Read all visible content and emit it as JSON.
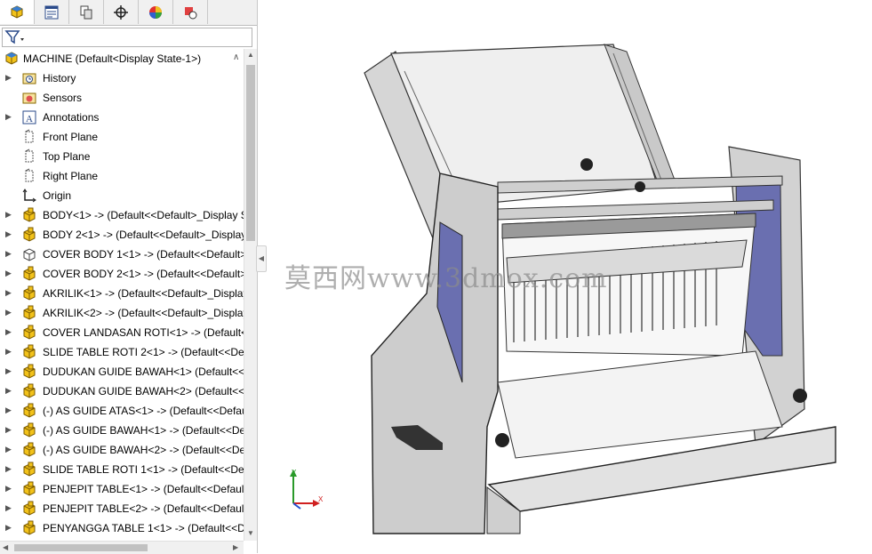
{
  "tabs": [
    {
      "name": "feature-manager-tab",
      "icon": "featuremanager-icon",
      "active": true
    },
    {
      "name": "property-manager-tab",
      "icon": "propertymanager-icon",
      "active": false
    },
    {
      "name": "configuration-manager-tab",
      "icon": "configurationmanager-icon",
      "active": false
    },
    {
      "name": "dimxpert-manager-tab",
      "icon": "crosshair-icon",
      "active": false
    },
    {
      "name": "display-manager-tab",
      "icon": "appearance-sphere-icon",
      "active": false
    },
    {
      "name": "extra-tab",
      "icon": "hand-tool-icon",
      "active": false
    }
  ],
  "filter": {
    "icon": "filter-icon"
  },
  "tree": {
    "root": {
      "label": "MACHINE  (Default<Display State-1>)",
      "icon": "assembly-icon"
    },
    "items": [
      {
        "label": "History",
        "icon": "history-folder-icon",
        "expander": true
      },
      {
        "label": "Sensors",
        "icon": "sensors-icon",
        "expander": false
      },
      {
        "label": "Annotations",
        "icon": "annotations-icon",
        "expander": true
      },
      {
        "label": "Front Plane",
        "icon": "plane-icon",
        "expander": false
      },
      {
        "label": "Top Plane",
        "icon": "plane-icon",
        "expander": false
      },
      {
        "label": "Right Plane",
        "icon": "plane-icon",
        "expander": false
      },
      {
        "label": "Origin",
        "icon": "origin-icon",
        "expander": false
      },
      {
        "label": "BODY<1> -> (Default<<Default>_Display S",
        "icon": "part-icon",
        "expander": true
      },
      {
        "label": "BODY 2<1> -> (Default<<Default>_Display",
        "icon": "part-icon",
        "expander": true
      },
      {
        "label": "COVER BODY 1<1> -> (Default<<Default>",
        "icon": "part-outline-icon",
        "expander": true
      },
      {
        "label": "COVER BODY 2<1> -> (Default<<Default>",
        "icon": "part-icon",
        "expander": true
      },
      {
        "label": "AKRILIK<1> -> (Default<<Default>_Display",
        "icon": "part-icon",
        "expander": true
      },
      {
        "label": "AKRILIK<2> -> (Default<<Default>_Display",
        "icon": "part-icon",
        "expander": true
      },
      {
        "label": "COVER LANDASAN ROTI<1> -> (Default<<",
        "icon": "part-icon",
        "expander": true
      },
      {
        "label": "SLIDE TABLE ROTI 2<1> -> (Default<<Defa",
        "icon": "part-icon",
        "expander": true
      },
      {
        "label": "DUDUKAN GUIDE BAWAH<1> (Default<<D",
        "icon": "part-icon",
        "expander": true
      },
      {
        "label": "DUDUKAN GUIDE BAWAH<2> (Default<<D",
        "icon": "part-icon",
        "expander": true
      },
      {
        "label": "(-) AS GUIDE ATAS<1> -> (Default<<Defau",
        "icon": "part-icon",
        "expander": true
      },
      {
        "label": "(-) AS GUIDE BAWAH<1> -> (Default<<De",
        "icon": "part-icon",
        "expander": true
      },
      {
        "label": "(-) AS GUIDE BAWAH<2> -> (Default<<De",
        "icon": "part-icon",
        "expander": true
      },
      {
        "label": "SLIDE TABLE ROTI 1<1> -> (Default<<Defa",
        "icon": "part-icon",
        "expander": true
      },
      {
        "label": "PENJEPIT TABLE<1> -> (Default<<Default>",
        "icon": "part-icon",
        "expander": true
      },
      {
        "label": "PENJEPIT TABLE<2> -> (Default<<Default>",
        "icon": "part-icon",
        "expander": true
      },
      {
        "label": "PENYANGGA TABLE 1<1> -> (Default<<De",
        "icon": "part-icon",
        "expander": true
      }
    ]
  },
  "watermark": "莫西网www.3dmox.com",
  "triad": {
    "x": "X",
    "y": "Y"
  },
  "colors": {
    "part": "#f2c21a",
    "accent": "#3a5fa8",
    "acrylic": "#6a6fb0",
    "metal": "#b8b8b8"
  }
}
